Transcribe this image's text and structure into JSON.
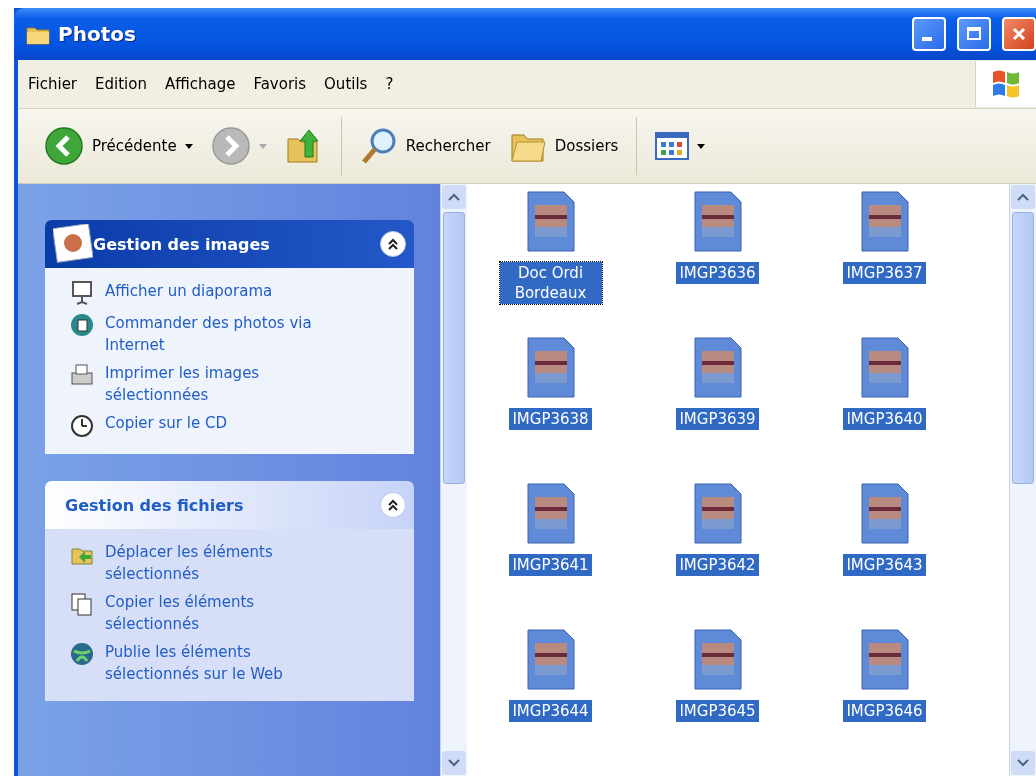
{
  "window": {
    "title": "Photos"
  },
  "menu": [
    "Fichier",
    "Edition",
    "Affichage",
    "Favoris",
    "Outils",
    "?"
  ],
  "toolbar": {
    "back": {
      "label": "Précédente"
    },
    "forward": {
      "disabled": true
    },
    "search": {
      "label": "Rechercher"
    },
    "folders": {
      "label": "Dossiers"
    }
  },
  "task_pane": {
    "sections": [
      {
        "title": "Gestion des images",
        "kind": "special",
        "expanded": true,
        "items": [
          "Afficher un diaporama",
          "Commander des photos via Internet",
          "Imprimer les images sélectionnées",
          "Copier sur le CD"
        ]
      },
      {
        "title": "Gestion des fichiers",
        "kind": "normal",
        "expanded": true,
        "items": [
          "Déplacer les éléments sélectionnés",
          "Copier les éléments sélectionnés",
          "Publie les éléments sélectionnés sur le Web"
        ]
      }
    ]
  },
  "files": [
    {
      "name": "Doc Ordi Bordeaux",
      "selected": true,
      "focused": true
    },
    {
      "name": "IMGP3636",
      "selected": true,
      "focused": false
    },
    {
      "name": "IMGP3637",
      "selected": true,
      "focused": false
    },
    {
      "name": "IMGP3638",
      "selected": true,
      "focused": false
    },
    {
      "name": "IMGP3639",
      "selected": true,
      "focused": false
    },
    {
      "name": "IMGP3640",
      "selected": true,
      "focused": false
    },
    {
      "name": "IMGP3641",
      "selected": true,
      "focused": false
    },
    {
      "name": "IMGP3642",
      "selected": true,
      "focused": false
    },
    {
      "name": "IMGP3643",
      "selected": true,
      "focused": false
    },
    {
      "name": "IMGP3644",
      "selected": true,
      "focused": false
    },
    {
      "name": "IMGP3645",
      "selected": true,
      "focused": false
    },
    {
      "name": "IMGP3646",
      "selected": true,
      "focused": false
    }
  ]
}
